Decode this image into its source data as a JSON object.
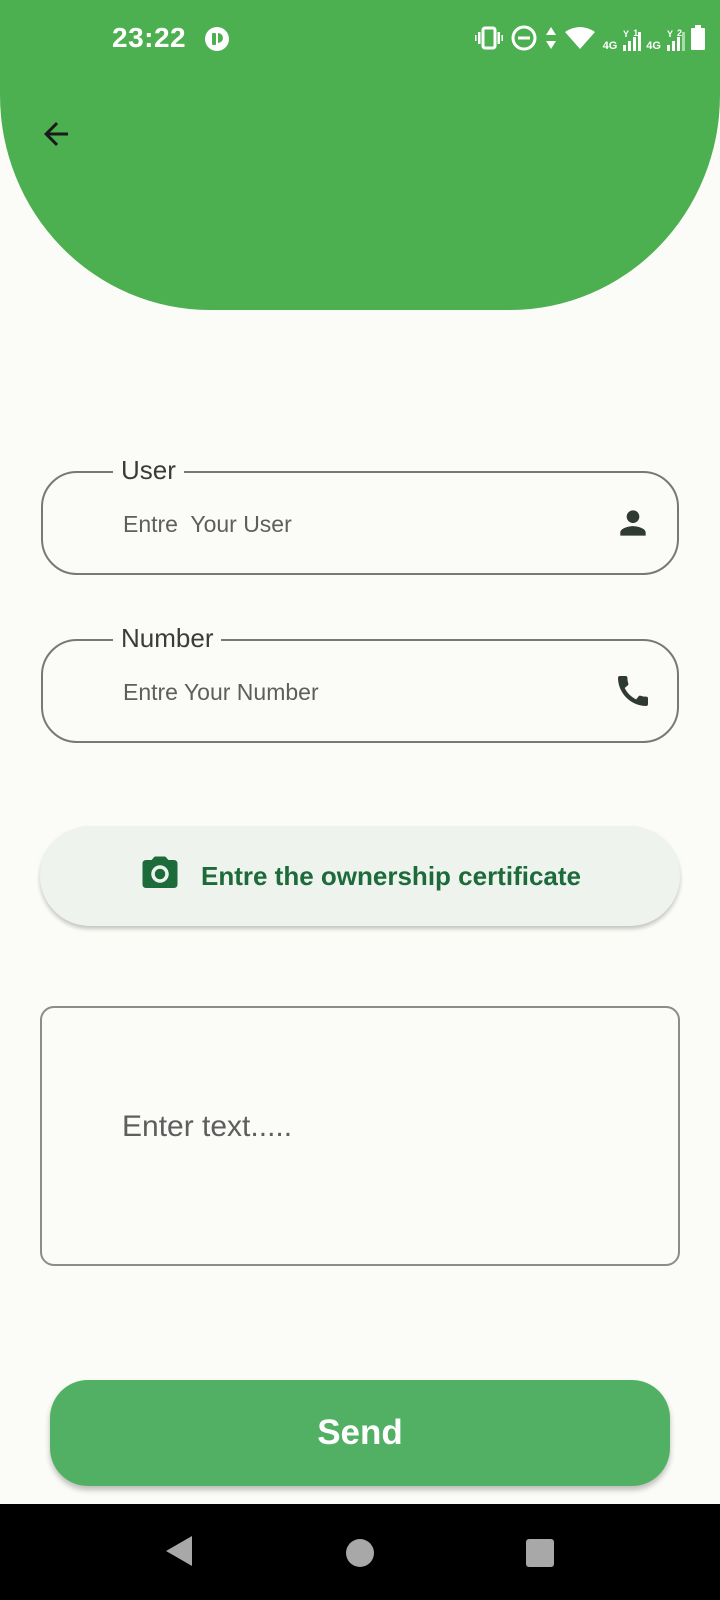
{
  "status_bar": {
    "time": "23:22",
    "icons": [
      "app-notification-icon",
      "vibrate-icon",
      "do-not-disturb-icon",
      "data-arrows-icon",
      "wifi-icon",
      "signal-sim1-icon",
      "signal-sim2-icon",
      "battery-icon"
    ],
    "network_sim1": "4G",
    "network_sim2": "4G",
    "sim1_index": "1",
    "sim2_index": "2"
  },
  "header": {
    "color": "#4caf50",
    "back_icon": "arrow-back-icon"
  },
  "form": {
    "user": {
      "label": "User",
      "placeholder": "Entre  Your User",
      "icon": "person-icon"
    },
    "number": {
      "label": "Number",
      "placeholder": "Entre Your Number",
      "icon": "phone-icon"
    },
    "certificate_button": {
      "label": "Entre the ownership certificate",
      "icon": "camera-icon",
      "text_color": "#1d6b3a"
    },
    "message": {
      "placeholder": "Enter text....."
    },
    "send_button": {
      "label": "Send",
      "color": "#52b065"
    }
  },
  "nav_bar": {
    "buttons": [
      "back-triangle-icon",
      "home-circle-icon",
      "recents-square-icon"
    ]
  }
}
